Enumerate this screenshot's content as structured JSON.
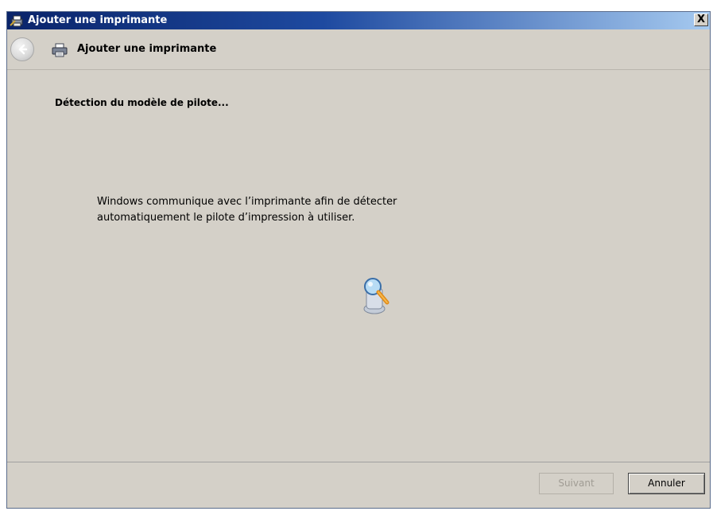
{
  "window": {
    "title": "Ajouter une imprimante",
    "close_label": "X"
  },
  "nav": {
    "title": "Ajouter une imprimante"
  },
  "content": {
    "heading": "Détection du modèle de pilote...",
    "message_line1": "Windows communique avec l’imprimante afin de détecter",
    "message_line2": "automatiquement le pilote d’impression à utiliser."
  },
  "footer": {
    "next_label": "Suivant",
    "next_enabled": false,
    "cancel_label": "Annuler"
  },
  "icons": {
    "title": "printer-wizard-icon",
    "back": "back-arrow-icon",
    "nav": "printer-icon",
    "detect": "magnifier-detect-icon"
  }
}
